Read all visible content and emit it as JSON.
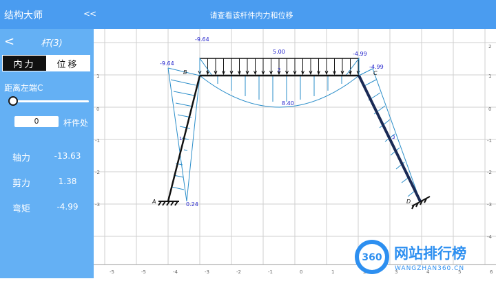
{
  "app": {
    "title": "结构大师",
    "collapse": "<<",
    "hint": "请查看该杆件内力和位移"
  },
  "panel": {
    "back": "<",
    "member": "杆(3)",
    "tabs": [
      "内力",
      "位移"
    ],
    "distance_label": "距离左端C",
    "slider_fraction": 0,
    "position_value": "0",
    "position_unit": "杆件处",
    "results": [
      {
        "label": "轴力",
        "value": "-13.63"
      },
      {
        "label": "剪力",
        "value": "1.38"
      },
      {
        "label": "弯矩",
        "value": "-4.99"
      }
    ]
  },
  "canvas": {
    "x_ticks": [
      "-6",
      "-5",
      "-5",
      "-4",
      "-3",
      "-2",
      "-1",
      "0",
      "1",
      "2",
      "3",
      "4",
      "5",
      "6",
      "7"
    ],
    "y_ticks_right": [
      "2",
      "1",
      "0",
      "-1",
      "-2",
      "-3",
      "-4"
    ],
    "y_ticks_left": [
      "1",
      "0",
      "-1",
      "-2",
      "-3"
    ],
    "node_labels": [
      "A",
      "B",
      "C",
      "D"
    ],
    "member_tags": [
      "1",
      "2",
      "3"
    ],
    "moment_values": [
      "-9.64",
      "-9.64",
      "5.00",
      "-4.99",
      "-4.99",
      "8.40",
      "0.24"
    ]
  },
  "watermark": {
    "brand": "网站排行榜",
    "number": "360",
    "url": "WANGZHAN360.CN"
  },
  "colors": {
    "topbar": "#4a9cf0",
    "side": "#64b0f4",
    "diagram": "#2a8dc9",
    "value_text": "#2222cc",
    "frame": "#111111"
  }
}
